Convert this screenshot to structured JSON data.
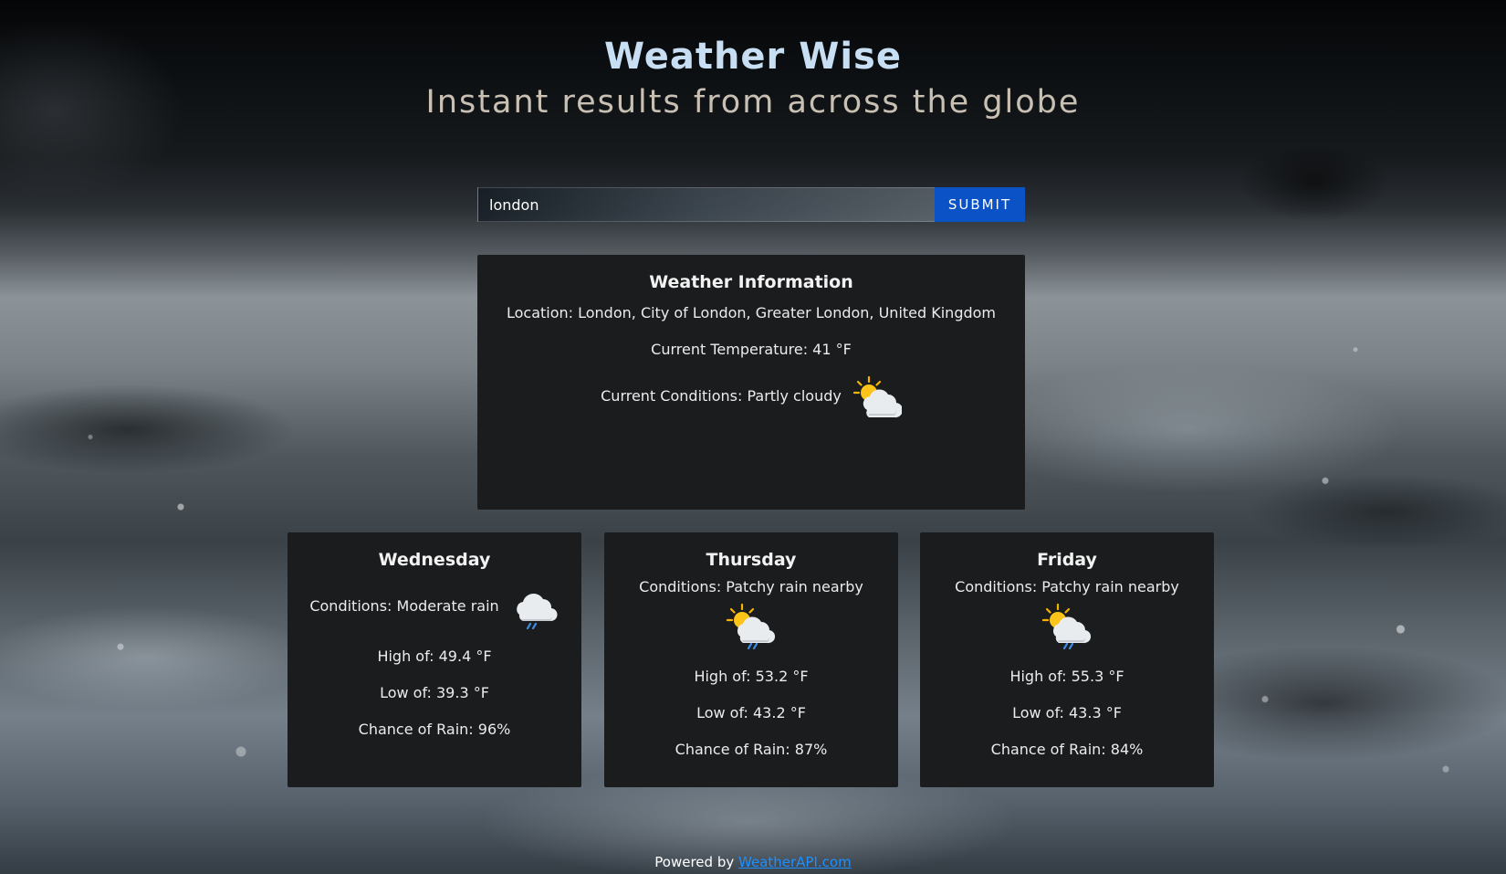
{
  "header": {
    "title": "Weather Wise",
    "subtitle": "Instant results from across the globe"
  },
  "search": {
    "value": "london",
    "submit_label": "SUBMIT"
  },
  "current": {
    "heading": "Weather Information",
    "location": "Location: London, City of London, Greater London, United Kingdom",
    "temperature": "Current Temperature: 41 °F",
    "conditions": "Current Conditions: Partly cloudy",
    "icon": "partly-cloudy-icon"
  },
  "forecast": [
    {
      "day": "Wednesday",
      "conditions": "Conditions: Moderate rain",
      "icon": "rain-cloud-icon",
      "high": "High of: 49.4 °F",
      "low": "Low of: 39.3 °F",
      "rain": "Chance of Rain: 96%"
    },
    {
      "day": "Thursday",
      "conditions": "Conditions: Patchy rain nearby",
      "icon": "sun-rain-cloud-icon",
      "high": "High of: 53.2 °F",
      "low": "Low of: 43.2 °F",
      "rain": "Chance of Rain: 87%"
    },
    {
      "day": "Friday",
      "conditions": "Conditions: Patchy rain nearby",
      "icon": "sun-rain-cloud-icon",
      "high": "High of: 55.3 °F",
      "low": "Low of: 43.3 °F",
      "rain": "Chance of Rain: 84%"
    }
  ],
  "footer": {
    "prefix": "Powered by",
    "link_text": "WeatherAPI.com"
  },
  "colors": {
    "title": "#c7def3",
    "subtitle": "#c9c0b4",
    "submit_button": "#0b52c7",
    "card_background": "#1b1c1e",
    "link": "#1e90ff"
  }
}
